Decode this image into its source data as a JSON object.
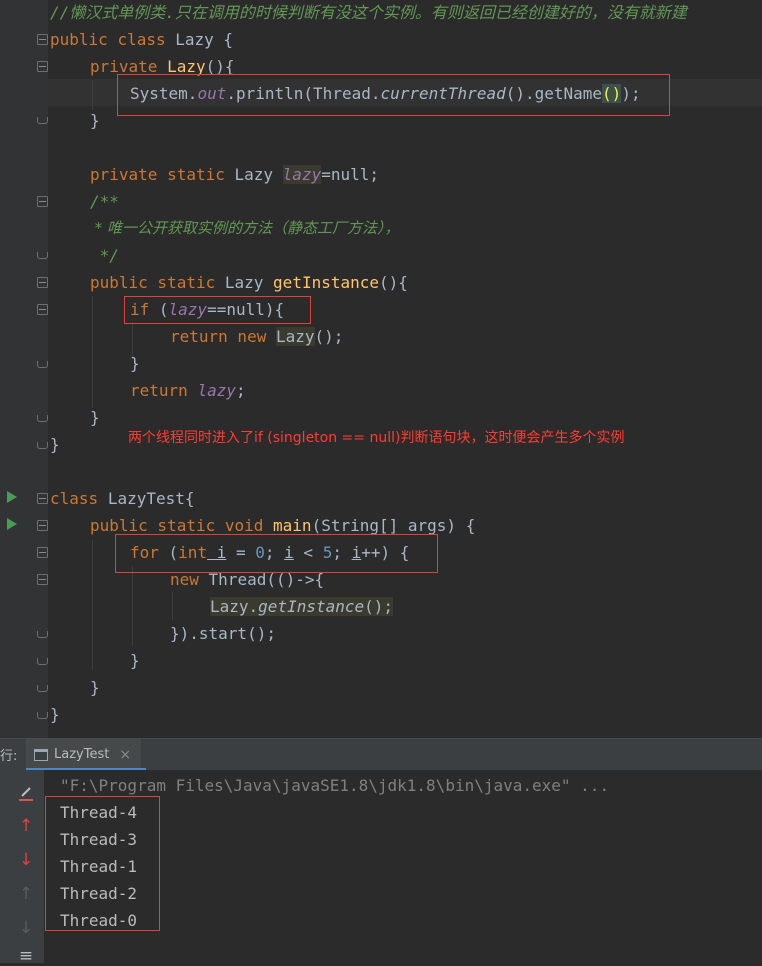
{
  "code": {
    "comment_top": "//懒汉式单例类.只在调用的时候判断有没这个实例。有则返回已经创建好的，没有就新建",
    "lazy_class": {
      "kw_public": "public",
      "kw_class": "class",
      "name": "Lazy",
      "brace": " {",
      "ctor_private": "private",
      "ctor_name": "Lazy",
      "ctor_paren": "(){",
      "println_obj": "System.",
      "println_out": "out",
      "println_method": ".println",
      "paren_open": "(",
      "thread_class": "Thread.",
      "current_thread": "currentThread",
      "cur_paren": "()",
      "get_name": ".getName",
      "gn_paren": "()",
      "paren_close": ");",
      "ctor_close": "}",
      "field_modifiers": "private static",
      "field_type": "Lazy",
      "field_name": "lazy",
      "field_init": "=null;",
      "doc_open": "/**",
      "doc_text": " * 唯一公开获取实例的方法（静态工厂方法），",
      "doc_close": " */",
      "method_modifiers": "public static",
      "method_type": "Lazy",
      "method_name": "getInstance",
      "method_paren": "(){",
      "if_kw": "if",
      "if_open": " (",
      "if_field": "lazy",
      "if_cond": "==null){",
      "return_kw": "return new",
      "return_class": "Lazy",
      "return_paren": "();",
      "if_close": "}",
      "return2_kw": "return",
      "return2_field": "lazy",
      "return2_semi": ";",
      "method_close": "}",
      "class_close": "}"
    },
    "annotation": "两个线程同时进入了if (singleton == null)判断语句块，这时便会产生多个实例",
    "test_class": {
      "kw_class": "class",
      "name": "LazyTest",
      "brace": "{",
      "main_modifiers": "public static void",
      "main_name": "main",
      "main_params": "(String[] args) {",
      "for_kw": "for",
      "for_open": " (",
      "for_int": "int",
      "for_var": " i",
      "for_eq": " = ",
      "for_zero": "0",
      "for_semi1": "; ",
      "for_var2": "i",
      "for_lt": " < ",
      "for_five": "5",
      "for_semi2": "; ",
      "for_var3": "i",
      "for_inc": "++) {",
      "new_kw": "new",
      "thread_ctor": " Thread",
      "lambda": "(()->{",
      "call_class": "Lazy.",
      "call_method": "getInstance",
      "call_paren": "();",
      "start": "}).start();",
      "for_close": "}",
      "main_close": "}",
      "class_close": "}"
    }
  },
  "run_panel": {
    "prefix": "行:",
    "tab_label": "LazyTest",
    "tab_close": "×",
    "command": "\"F:\\Program Files\\Java\\javaSE1.8\\jdk1.8\\bin\\java.exe\" ...",
    "output": [
      "Thread-4",
      "Thread-3",
      "Thread-1",
      "Thread-2",
      "Thread-0"
    ]
  },
  "colors": {
    "editor_bg": "#2b2b2b",
    "keyword": "#cc7832",
    "annotation_red": "#ff3c32",
    "highlight_box": "#e0413c"
  }
}
